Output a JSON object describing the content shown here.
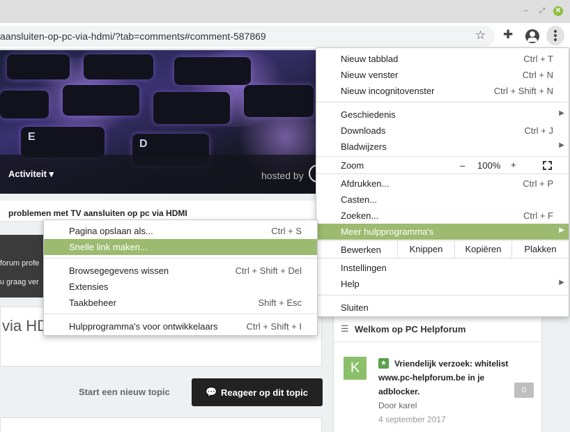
{
  "window": {
    "minimize_glyph": "–",
    "maximize_glyph": "⤢",
    "close_glyph": "✕",
    "accent": "#8fbf3f"
  },
  "toolbar": {
    "url": "aansluiten-op-pc-via-hdmi/?tab=comments#comment-587869",
    "icons": [
      "bookmark-star-icon",
      "extensions-icon",
      "profile-icon",
      "menu-kebab-icon"
    ]
  },
  "page": {
    "hero_keys": [
      "E",
      "D"
    ],
    "activity_label": "Activiteit",
    "activity_caret": "▾",
    "hosted_by": "hosted by",
    "breadcrumb": "problemen met TV aansluiten op pc via HDMI",
    "dark_lines": [
      "forum profe",
      "u graag ver"
    ],
    "topic_title": "via HD",
    "start_topic": "Start een nieuw topic",
    "reply_button": "Reageer op dit topic",
    "sidebar": {
      "title": "Welkom op PC Helpforum",
      "avatar_letter": "K",
      "post_title_lines": [
        "Vriendelijk verzoek: whitelist",
        "www.pc-helpforum.be in je",
        "adblocker."
      ],
      "author": "Door karel",
      "date": "4 september 2017",
      "count": "0"
    }
  },
  "menu": {
    "highlight_color": "#9cbb70",
    "new_tab": {
      "label": "Nieuw tabblad",
      "shortcut": "Ctrl + T"
    },
    "new_window": {
      "label": "Nieuw venster",
      "shortcut": "Ctrl + N"
    },
    "incognito": {
      "label": "Nieuw incognitovenster",
      "shortcut": "Ctrl + Shift + N"
    },
    "history": {
      "label": "Geschiedenis"
    },
    "downloads": {
      "label": "Downloads",
      "shortcut": "Ctrl + J"
    },
    "bookmarks": {
      "label": "Bladwijzers"
    },
    "zoom": {
      "label": "Zoom",
      "minus": "–",
      "value": "100%",
      "plus": "+"
    },
    "print": {
      "label": "Afdrukken...",
      "shortcut": "Ctrl + P"
    },
    "cast": {
      "label": "Casten..."
    },
    "find": {
      "label": "Zoeken...",
      "shortcut": "Ctrl + F"
    },
    "more_tools": {
      "label": "Meer hulpprogramma's"
    },
    "edit": {
      "label": "Bewerken",
      "cut": "Knippen",
      "copy": "Kopiëren",
      "paste": "Plakken"
    },
    "settings": {
      "label": "Instellingen"
    },
    "help": {
      "label": "Help"
    },
    "exit": {
      "label": "Sluiten"
    }
  },
  "submenu": {
    "save_page": {
      "label": "Pagina opslaan als...",
      "shortcut": "Ctrl + S"
    },
    "create_shortcut": {
      "label": "Snelle link maken..."
    },
    "clear_data": {
      "label": "Browsegegevens wissen",
      "shortcut": "Ctrl + Shift + Del"
    },
    "extensions": {
      "label": "Extensies"
    },
    "task_manager": {
      "label": "Taakbeheer",
      "shortcut": "Shift + Esc"
    },
    "dev_tools": {
      "label": "Hulpprogramma's voor ontwikkelaars",
      "shortcut": "Ctrl + Shift + I"
    }
  }
}
